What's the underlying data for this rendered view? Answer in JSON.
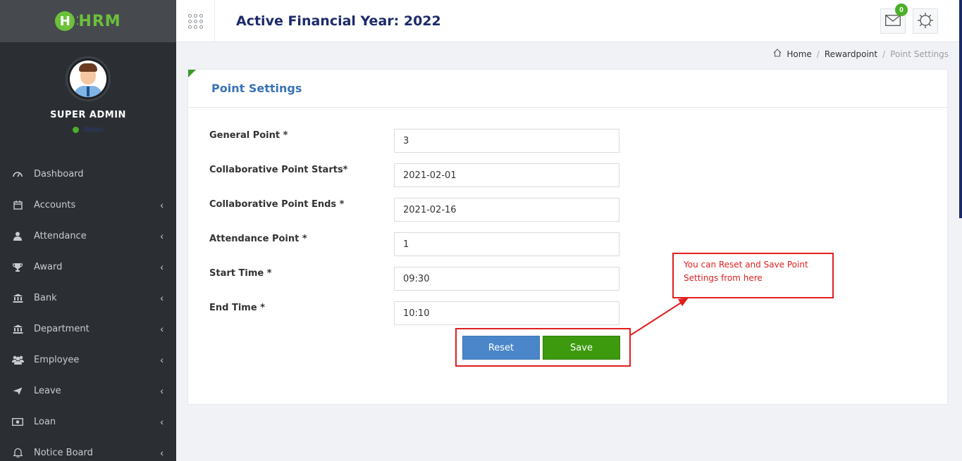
{
  "sidebar": {
    "logo": {
      "letter": "H",
      "text": "HRM"
    },
    "user": {
      "name": "SUPER ADMIN",
      "status": "Admin"
    },
    "items": [
      {
        "label": "Dashboard",
        "icon": "dashboard-icon",
        "has_submenu": false
      },
      {
        "label": "Accounts",
        "icon": "calendar-icon",
        "has_submenu": true
      },
      {
        "label": "Attendance",
        "icon": "user-icon",
        "has_submenu": true
      },
      {
        "label": "Award",
        "icon": "trophy-icon",
        "has_submenu": true
      },
      {
        "label": "Bank",
        "icon": "bank-icon",
        "has_submenu": true
      },
      {
        "label": "Department",
        "icon": "bank-icon",
        "has_submenu": true
      },
      {
        "label": "Employee",
        "icon": "users-icon",
        "has_submenu": true
      },
      {
        "label": "Leave",
        "icon": "plane-icon",
        "has_submenu": true
      },
      {
        "label": "Loan",
        "icon": "money-icon",
        "has_submenu": true
      },
      {
        "label": "Notice Board",
        "icon": "bell-icon",
        "has_submenu": true
      }
    ]
  },
  "header": {
    "title": "Active Financial Year: 2022",
    "mail_badge": "0"
  },
  "breadcrumb": {
    "home": "Home",
    "section": "Rewardpoint",
    "current": "Point Settings"
  },
  "card": {
    "title": "Point Settings"
  },
  "form": {
    "fields": [
      {
        "label": "General Point *",
        "value": "3"
      },
      {
        "label": "Collaborative Point Starts*",
        "value": "2021-02-01"
      },
      {
        "label": "Collaborative Point Ends *",
        "value": "2021-02-16"
      },
      {
        "label": "Attendance Point *",
        "value": "1"
      },
      {
        "label": "Start Time *",
        "value": "09:30"
      },
      {
        "label": "End Time *",
        "value": "10:10"
      }
    ],
    "reset_label": "Reset",
    "save_label": "Save"
  },
  "annotation": {
    "text": "You can Reset and Save Point Settings from here",
    "color": "#e01f1f"
  },
  "colors": {
    "sidebar_bg": "#2b2f33",
    "brand_green": "#6cc13a",
    "title_navy": "#1d2a6b",
    "card_title_blue": "#3a73b5",
    "reset_blue": "#4a86c9",
    "save_green": "#3d9a0e"
  }
}
